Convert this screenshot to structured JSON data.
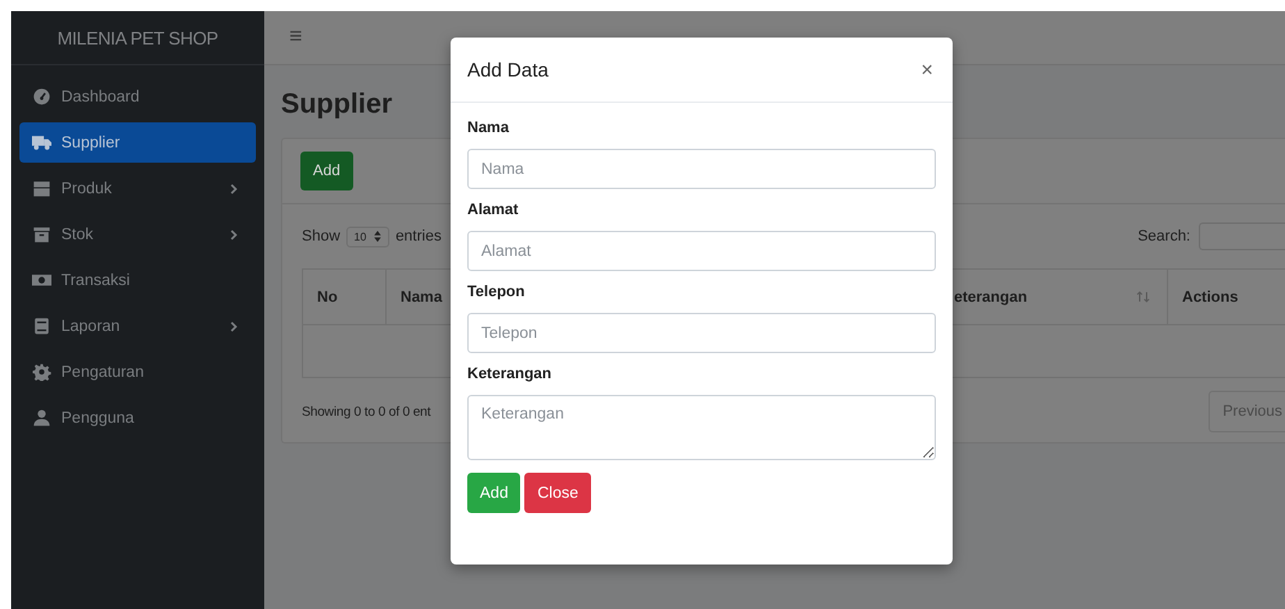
{
  "brand": "MILENIA PET SHOP",
  "topbar": {
    "menu_glyph": "≡"
  },
  "sidebar": {
    "items": [
      {
        "label": "Dashboard",
        "kind": "gauge",
        "selected": false,
        "expandable": false
      },
      {
        "label": "Supplier",
        "kind": "truck",
        "selected": true,
        "expandable": false
      },
      {
        "label": "Produk",
        "kind": "box",
        "selected": false,
        "expandable": true
      },
      {
        "label": "Stok",
        "kind": "archive",
        "selected": false,
        "expandable": true
      },
      {
        "label": "Transaksi",
        "kind": "money",
        "selected": false,
        "expandable": false
      },
      {
        "label": "Laporan",
        "kind": "book",
        "selected": false,
        "expandable": true
      },
      {
        "label": "Pengaturan",
        "kind": "gear",
        "selected": false,
        "expandable": false
      },
      {
        "label": "Pengguna",
        "kind": "user",
        "selected": false,
        "expandable": false
      }
    ]
  },
  "page": {
    "title": "Supplier",
    "add_button": "Add",
    "show_label": "Show",
    "page_length": "10",
    "entries_label": "entries",
    "search_label": "Search:",
    "table": {
      "columns": [
        {
          "label": "No"
        },
        {
          "label": "Nama"
        },
        {
          "label": "eterangan",
          "sortable": true
        },
        {
          "label": "Actions"
        }
      ]
    },
    "info": "Showing 0 to 0 of 0 ent",
    "previous_button": "Previous"
  },
  "modal": {
    "title": "Add Data",
    "close": "×",
    "fields": [
      {
        "label": "Nama",
        "placeholder": "Nama",
        "kind": "input"
      },
      {
        "label": "Alamat",
        "placeholder": "Alamat",
        "kind": "input"
      },
      {
        "label": "Telepon",
        "placeholder": "Telepon",
        "kind": "input"
      },
      {
        "label": "Keterangan",
        "placeholder": "Keterangan",
        "kind": "textarea"
      }
    ],
    "buttons": [
      {
        "label": "Add",
        "kind": "success"
      },
      {
        "label": "Close",
        "kind": "danger"
      }
    ]
  }
}
